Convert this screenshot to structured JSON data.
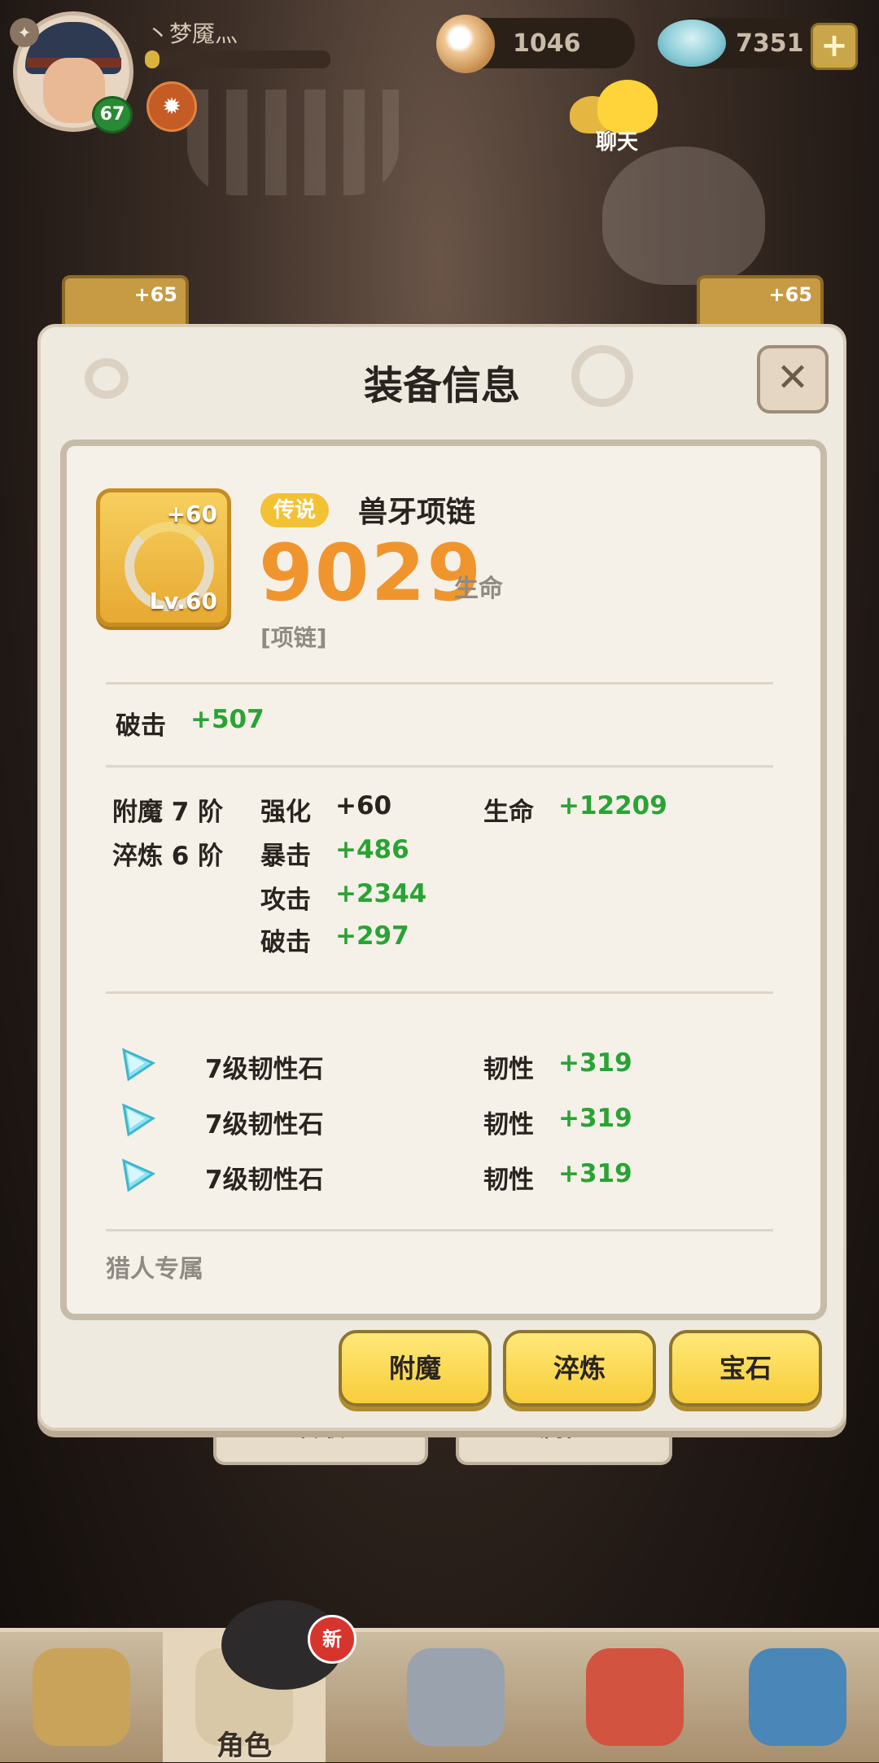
{
  "player": {
    "name": "丶梦魇灬",
    "level": "67",
    "exp_fraction": 0.08
  },
  "currency": {
    "pearls": "1046",
    "gems": "7351"
  },
  "chat": {
    "label": "聊天"
  },
  "side_slots": {
    "left_plus": "+65",
    "right_plus": "+65"
  },
  "modal": {
    "title": "装备信息",
    "close_icon": "close-icon",
    "item": {
      "rarity": "传说",
      "name": "兽牙项链",
      "power": "9029",
      "power_stat": "生命",
      "type": "[项链]",
      "enhance": "+60",
      "level": "Lv.60"
    },
    "base_stat": {
      "label": "破击",
      "value": "+507"
    },
    "tiers": {
      "enchant": "附魔 7 阶",
      "refine": "淬炼 6 阶"
    },
    "enhance_stats": [
      {
        "label": "强化",
        "value": "+60"
      },
      {
        "label": "暴击",
        "value": "+486"
      },
      {
        "label": "攻击",
        "value": "+2344"
      },
      {
        "label": "破击",
        "value": "+297"
      }
    ],
    "extra_stat": {
      "label": "生命",
      "value": "+12209"
    },
    "gems": [
      {
        "name": "7级韧性石",
        "stat": "韧性",
        "value": "+319"
      },
      {
        "name": "7级韧性石",
        "stat": "韧性",
        "value": "+319"
      },
      {
        "name": "7级韧性石",
        "stat": "韧性",
        "value": "+319"
      }
    ],
    "exclusive": "猎人专属",
    "buttons": {
      "enchant": "附魔",
      "refine": "淬炼",
      "gem": "宝石"
    }
  },
  "behind_modal": {
    "left_button": "转职",
    "right_button": "属性"
  },
  "bottom_nav": {
    "active_label": "角色",
    "new_badge": "新"
  },
  "colors": {
    "legendary_badge": "#f2c234",
    "power_orange": "#f0952e",
    "stat_green": "#2aa335",
    "action_button": "#f7cd3a"
  }
}
